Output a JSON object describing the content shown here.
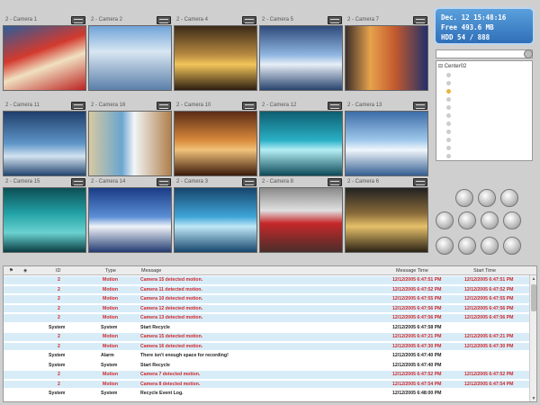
{
  "status": {
    "date": "Dec. 12 15:48:16",
    "free": "Free 493.6 MB",
    "hdd": "HDD   54 / 888"
  },
  "tree": {
    "root": "Center02"
  },
  "cameras": [
    {
      "label": "2 - Camera 1",
      "scene": "store-red"
    },
    {
      "label": "2 - Camera 2",
      "scene": "parking"
    },
    {
      "label": "2 - Camera 4",
      "scene": "control-room"
    },
    {
      "label": "2 - Camera 5",
      "scene": "control-room-blue"
    },
    {
      "label": "2 - Camera 7",
      "scene": "shelves"
    },
    {
      "label": "2 - Camera 11",
      "scene": "crowd"
    },
    {
      "label": "2 - Camera 16",
      "scene": "warehouse"
    },
    {
      "label": "2 - Camera 10",
      "scene": "shop"
    },
    {
      "label": "2 - Camera 12",
      "scene": "subway-hall"
    },
    {
      "label": "2 - Camera 13",
      "scene": "crowd-blue"
    },
    {
      "label": "2 - Camera 15",
      "scene": "teal"
    },
    {
      "label": "2 - Camera 14",
      "scene": "street"
    },
    {
      "label": "2 - Camera 3",
      "scene": "people"
    },
    {
      "label": "2 - Camera 8",
      "scene": "train"
    },
    {
      "label": "2 - Camera 6",
      "scene": "stairs"
    }
  ],
  "log": {
    "headers": [
      "ID",
      "Type",
      "Message",
      "Message Time",
      "Start Time"
    ],
    "rows": [
      {
        "id": "2",
        "type": "Motion",
        "msg": "Camera 15 detected motion.",
        "mtime": "12/12/2005 6:47:51 PM",
        "stime": "12/12/2005 6:47:51 PM",
        "color": "red",
        "alt": true
      },
      {
        "id": "2",
        "type": "Motion",
        "msg": "Camera 11 detected motion.",
        "mtime": "12/12/2005 6:47:52 PM",
        "stime": "12/12/2005 6:47:52 PM",
        "color": "red",
        "alt": true
      },
      {
        "id": "2",
        "type": "Motion",
        "msg": "Camera 10 detected motion.",
        "mtime": "12/12/2005 6:47:55 PM",
        "stime": "12/12/2005 6:47:55 PM",
        "color": "red",
        "alt": true
      },
      {
        "id": "2",
        "type": "Motion",
        "msg": "Camera 12 detected motion.",
        "mtime": "12/12/2005 6:47:56 PM",
        "stime": "12/12/2005 6:47:56 PM",
        "color": "red",
        "alt": true
      },
      {
        "id": "2",
        "type": "Motion",
        "msg": "Camera 13 detected motion.",
        "mtime": "12/12/2005 6:47:56 PM",
        "stime": "12/12/2005 6:47:56 PM",
        "color": "red",
        "alt": true
      },
      {
        "id": "System",
        "type": "System",
        "msg": "Start Recycle",
        "mtime": "12/12/2005 6:47:58 PM",
        "stime": "",
        "color": "black",
        "alt": false
      },
      {
        "id": "2",
        "type": "Motion",
        "msg": "Camera 15 detected motion.",
        "mtime": "12/12/2005 6:47:21 PM",
        "stime": "12/12/2005 6:47:21 PM",
        "color": "red",
        "alt": true
      },
      {
        "id": "2",
        "type": "Motion",
        "msg": "Camera 16 detected motion.",
        "mtime": "12/12/2005 6:47:30 PM",
        "stime": "12/12/2005 6:47:30 PM",
        "color": "red",
        "alt": true
      },
      {
        "id": "System",
        "type": "Alarm",
        "msg": "There isn't enough space for recording!",
        "mtime": "12/12/2005 6:47:40 PM",
        "stime": "",
        "color": "black",
        "alt": false
      },
      {
        "id": "System",
        "type": "System",
        "msg": "Start Recycle",
        "mtime": "12/12/2005 6:47:40 PM",
        "stime": "",
        "color": "black",
        "alt": false
      },
      {
        "id": "2",
        "type": "Motion",
        "msg": "Camera 7 detected motion.",
        "mtime": "12/12/2005 6:47:52 PM",
        "stime": "12/12/2005 6:47:52 PM",
        "color": "red",
        "alt": true
      },
      {
        "id": "2",
        "type": "Motion",
        "msg": "Camera 8 detected motion.",
        "mtime": "12/12/2005 6:47:54 PM",
        "stime": "12/12/2005 6:47:54 PM",
        "color": "red",
        "alt": true
      },
      {
        "id": "System",
        "type": "System",
        "msg": "Recycle Event Log.",
        "mtime": "12/12/2005 6:48:00 PM",
        "stime": "",
        "color": "black",
        "alt": false
      }
    ]
  }
}
